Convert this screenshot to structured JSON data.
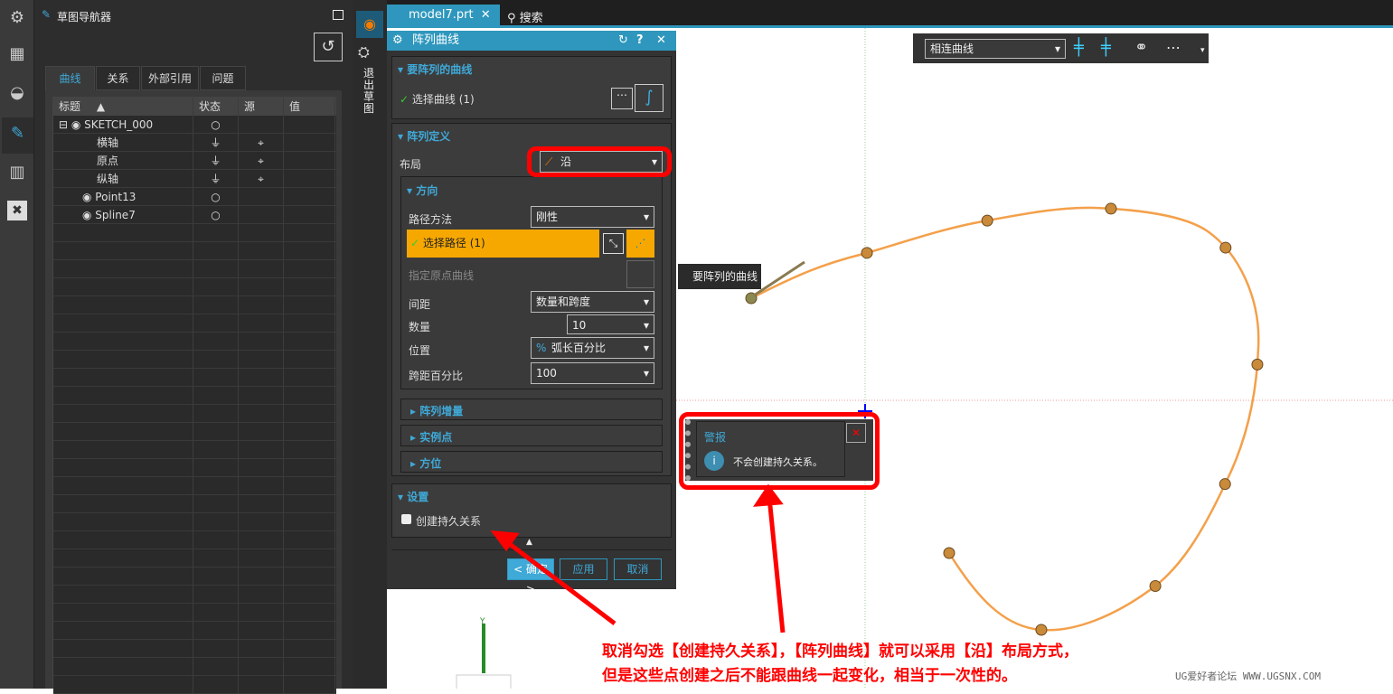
{
  "navigator": {
    "title": "草图导航器",
    "tabs": [
      "曲线",
      "关系",
      "外部引用",
      "问题"
    ],
    "columns": [
      "标题",
      "状态",
      "源",
      "值"
    ],
    "rows": [
      {
        "name": "SKETCH_000",
        "status": "○",
        "source": ""
      },
      {
        "name": "横轴",
        "status": "⏚",
        "source": "⌖"
      },
      {
        "name": "原点",
        "status": "⏚",
        "source": "⌖"
      },
      {
        "name": "纵轴",
        "status": "⏚",
        "source": "⌖"
      },
      {
        "name": "Point13",
        "status": "○",
        "source": ""
      },
      {
        "name": "Spline7",
        "status": "○",
        "source": ""
      }
    ]
  },
  "side_label": "退出草图",
  "tabbar": {
    "file": "model7.prt",
    "search": "搜索"
  },
  "dialog": {
    "title": "阵列曲线",
    "sec_curves": "要阵列的曲线",
    "select_curve": "选择曲线 (1)",
    "sec_def": "阵列定义",
    "layout_label": "布局",
    "layout_value": "沿",
    "sec_dir": "方向",
    "path_method_label": "路径方法",
    "path_method_value": "刚性",
    "select_path": "选择路径 (1)",
    "origin_curve": "指定原点曲线",
    "spacing_label": "间距",
    "spacing_value": "数量和跨度",
    "count_label": "数量",
    "count_value": "10",
    "position_label": "位置",
    "position_value": "弧长百分比",
    "span_label": "跨距百分比",
    "span_value": "100",
    "sec_incr": "阵列增量",
    "sec_inst": "实例点",
    "sec_orient": "方位",
    "sec_settings": "设置",
    "persist_label": "创建持久关系",
    "persist_checked": false,
    "ok": "< 确定 >",
    "apply": "应用",
    "cancel": "取消"
  },
  "toolbar": {
    "curve_rule": "相连曲线"
  },
  "tooltip": "要阵列的曲线",
  "alert": {
    "title": "警报",
    "message": "不会创建持久关系。"
  },
  "annotation": {
    "line1": "取消勾选【创建持久关系】，【阵列曲线】就可以采用【沿】布局方式，",
    "line2": "但是这些点创建之后不能跟曲线一起变化，相当于一次性的。"
  },
  "watermark": "UG爱好者论坛 WWW.UGSNX.COM",
  "colors": {
    "accent": "#2f97bd",
    "highlight": "#f7a800",
    "curve": "#f4a04a",
    "annotation": "#ff0000"
  }
}
